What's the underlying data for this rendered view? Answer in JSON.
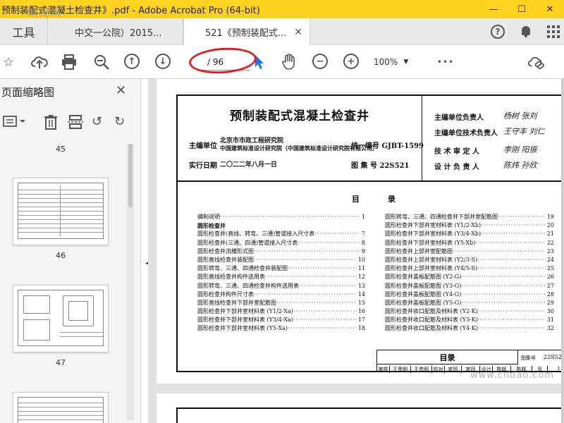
{
  "window": {
    "title": "预制装配式混凝土检查井》.pdf - Adobe Acrobat Pro (64-bit)",
    "minimize": "—",
    "maximize": "☐",
    "close": "✕",
    "watermark": "筑龙网"
  },
  "tabs": {
    "home": "工具",
    "tab1": "中交一公院）2015...",
    "tab2": "521《预制装配式...",
    "tab2_close": "✕"
  },
  "toolbar": {
    "page_indicator": "/ 96",
    "zoom": "100%",
    "more": "•••"
  },
  "sidebar": {
    "title": "页面缩略图",
    "close": "✕",
    "page_labels": [
      "45",
      "46",
      "47"
    ]
  },
  "document": {
    "title": "预制装配式混凝土检查井",
    "editor_label": "主编单位",
    "editor_line1": "北京市市政工程研究院",
    "editor_line2": "中国建筑标准设计研究院（中国建筑标准设计研究院有限公司）",
    "unified_no": "统一编号 GJBT-1599",
    "effective_label": "实行日期",
    "effective_date": "二〇二二年八月一日",
    "atlas_no": "图 集 号 22S521",
    "roles": [
      "主编单位负责人",
      "主编单位技术负责人",
      "技 术 审 定 人",
      "设 计 负 责 人"
    ],
    "signatures": [
      "杨树 张刘",
      "王守丰 刘仁",
      "李刚 阳振",
      "陈炜 孙欣"
    ],
    "toc_title": "目录",
    "toc_left": [
      {
        "name": "编制说明",
        "page": "1"
      },
      {
        "name": "圆形检查井",
        "page": ""
      },
      {
        "name": "圆形检查井(直线、转弯、三通)管道接入尺寸表",
        "page": "7"
      },
      {
        "name": "圆形检查井(三通、四通)管道接入尺寸表",
        "page": "8"
      },
      {
        "name": "圆形检查井流槽形式图",
        "page": "9"
      },
      {
        "name": "圆形直线检查井装配图",
        "page": "10"
      },
      {
        "name": "圆形转弯、三通、四通检查井装配图",
        "page": "11"
      },
      {
        "name": "圆形直线检查井构件选用表",
        "page": "12"
      },
      {
        "name": "圆形转弯、三通、四通检查井构件选用表",
        "page": "13"
      },
      {
        "name": "圆形检查井构件尺寸表",
        "page": "14"
      },
      {
        "name": "圆形直线检查井下部井室配筋图",
        "page": "15"
      },
      {
        "name": "圆形检查井下部井室材料表 (Y1/2-Xa)",
        "page": "16"
      },
      {
        "name": "圆形检查井下部井室材料表 (Y3/4-Xa)",
        "page": "17"
      },
      {
        "name": "圆形检查井下部井室材料表 (Y5-Xa)",
        "page": "18"
      }
    ],
    "toc_right": [
      {
        "name": "圆形转弯、三通、四通检查井下部井室配筋图",
        "page": "19"
      },
      {
        "name": "圆形检查井下部井室材料表 (Y1/2-Xb)",
        "page": "20"
      },
      {
        "name": "圆形检查井下部井室材料表 (Y3/4-Xb)",
        "page": "21"
      },
      {
        "name": "圆形检查井下部井室材料表 (Y5-Xb)",
        "page": "22"
      },
      {
        "name": "圆形检查井上部井室配筋图",
        "page": "23"
      },
      {
        "name": "圆形检查井上部井室材料表 (Y2/3-S)",
        "page": "24"
      },
      {
        "name": "圆形检查井上部井室材料表 (Y4/5-S)",
        "page": "25"
      },
      {
        "name": "圆形检查井盖板配筋图 (Y2-G)",
        "page": "26"
      },
      {
        "name": "圆形检查井盖板配筋图 (Y3-G)",
        "page": "27"
      },
      {
        "name": "圆形检查井盖板配筋图 (Y4-G)",
        "page": "28"
      },
      {
        "name": "圆形检查井盖板配筋图 (Y5-G)",
        "page": "29"
      },
      {
        "name": "圆形检查井收口配筋及材料表 (Y2-K)",
        "page": "30"
      },
      {
        "name": "圆形检查井收口配筋及材料表 (Y3-K)",
        "page": "31"
      },
      {
        "name": "圆形检查井收口配筋及材料表 (Y4-K)",
        "page": "32"
      }
    ],
    "titleblock": {
      "name": "目录",
      "atlas_label": "图集号",
      "atlas_value": "22S521",
      "row2": [
        "审核",
        "王贵明",
        "王贵明",
        "校对",
        "崔固",
        "崔固",
        "设计",
        "陈辉",
        "陈辉",
        "页",
        "1"
      ]
    },
    "watermark": "www.cndao.com"
  }
}
